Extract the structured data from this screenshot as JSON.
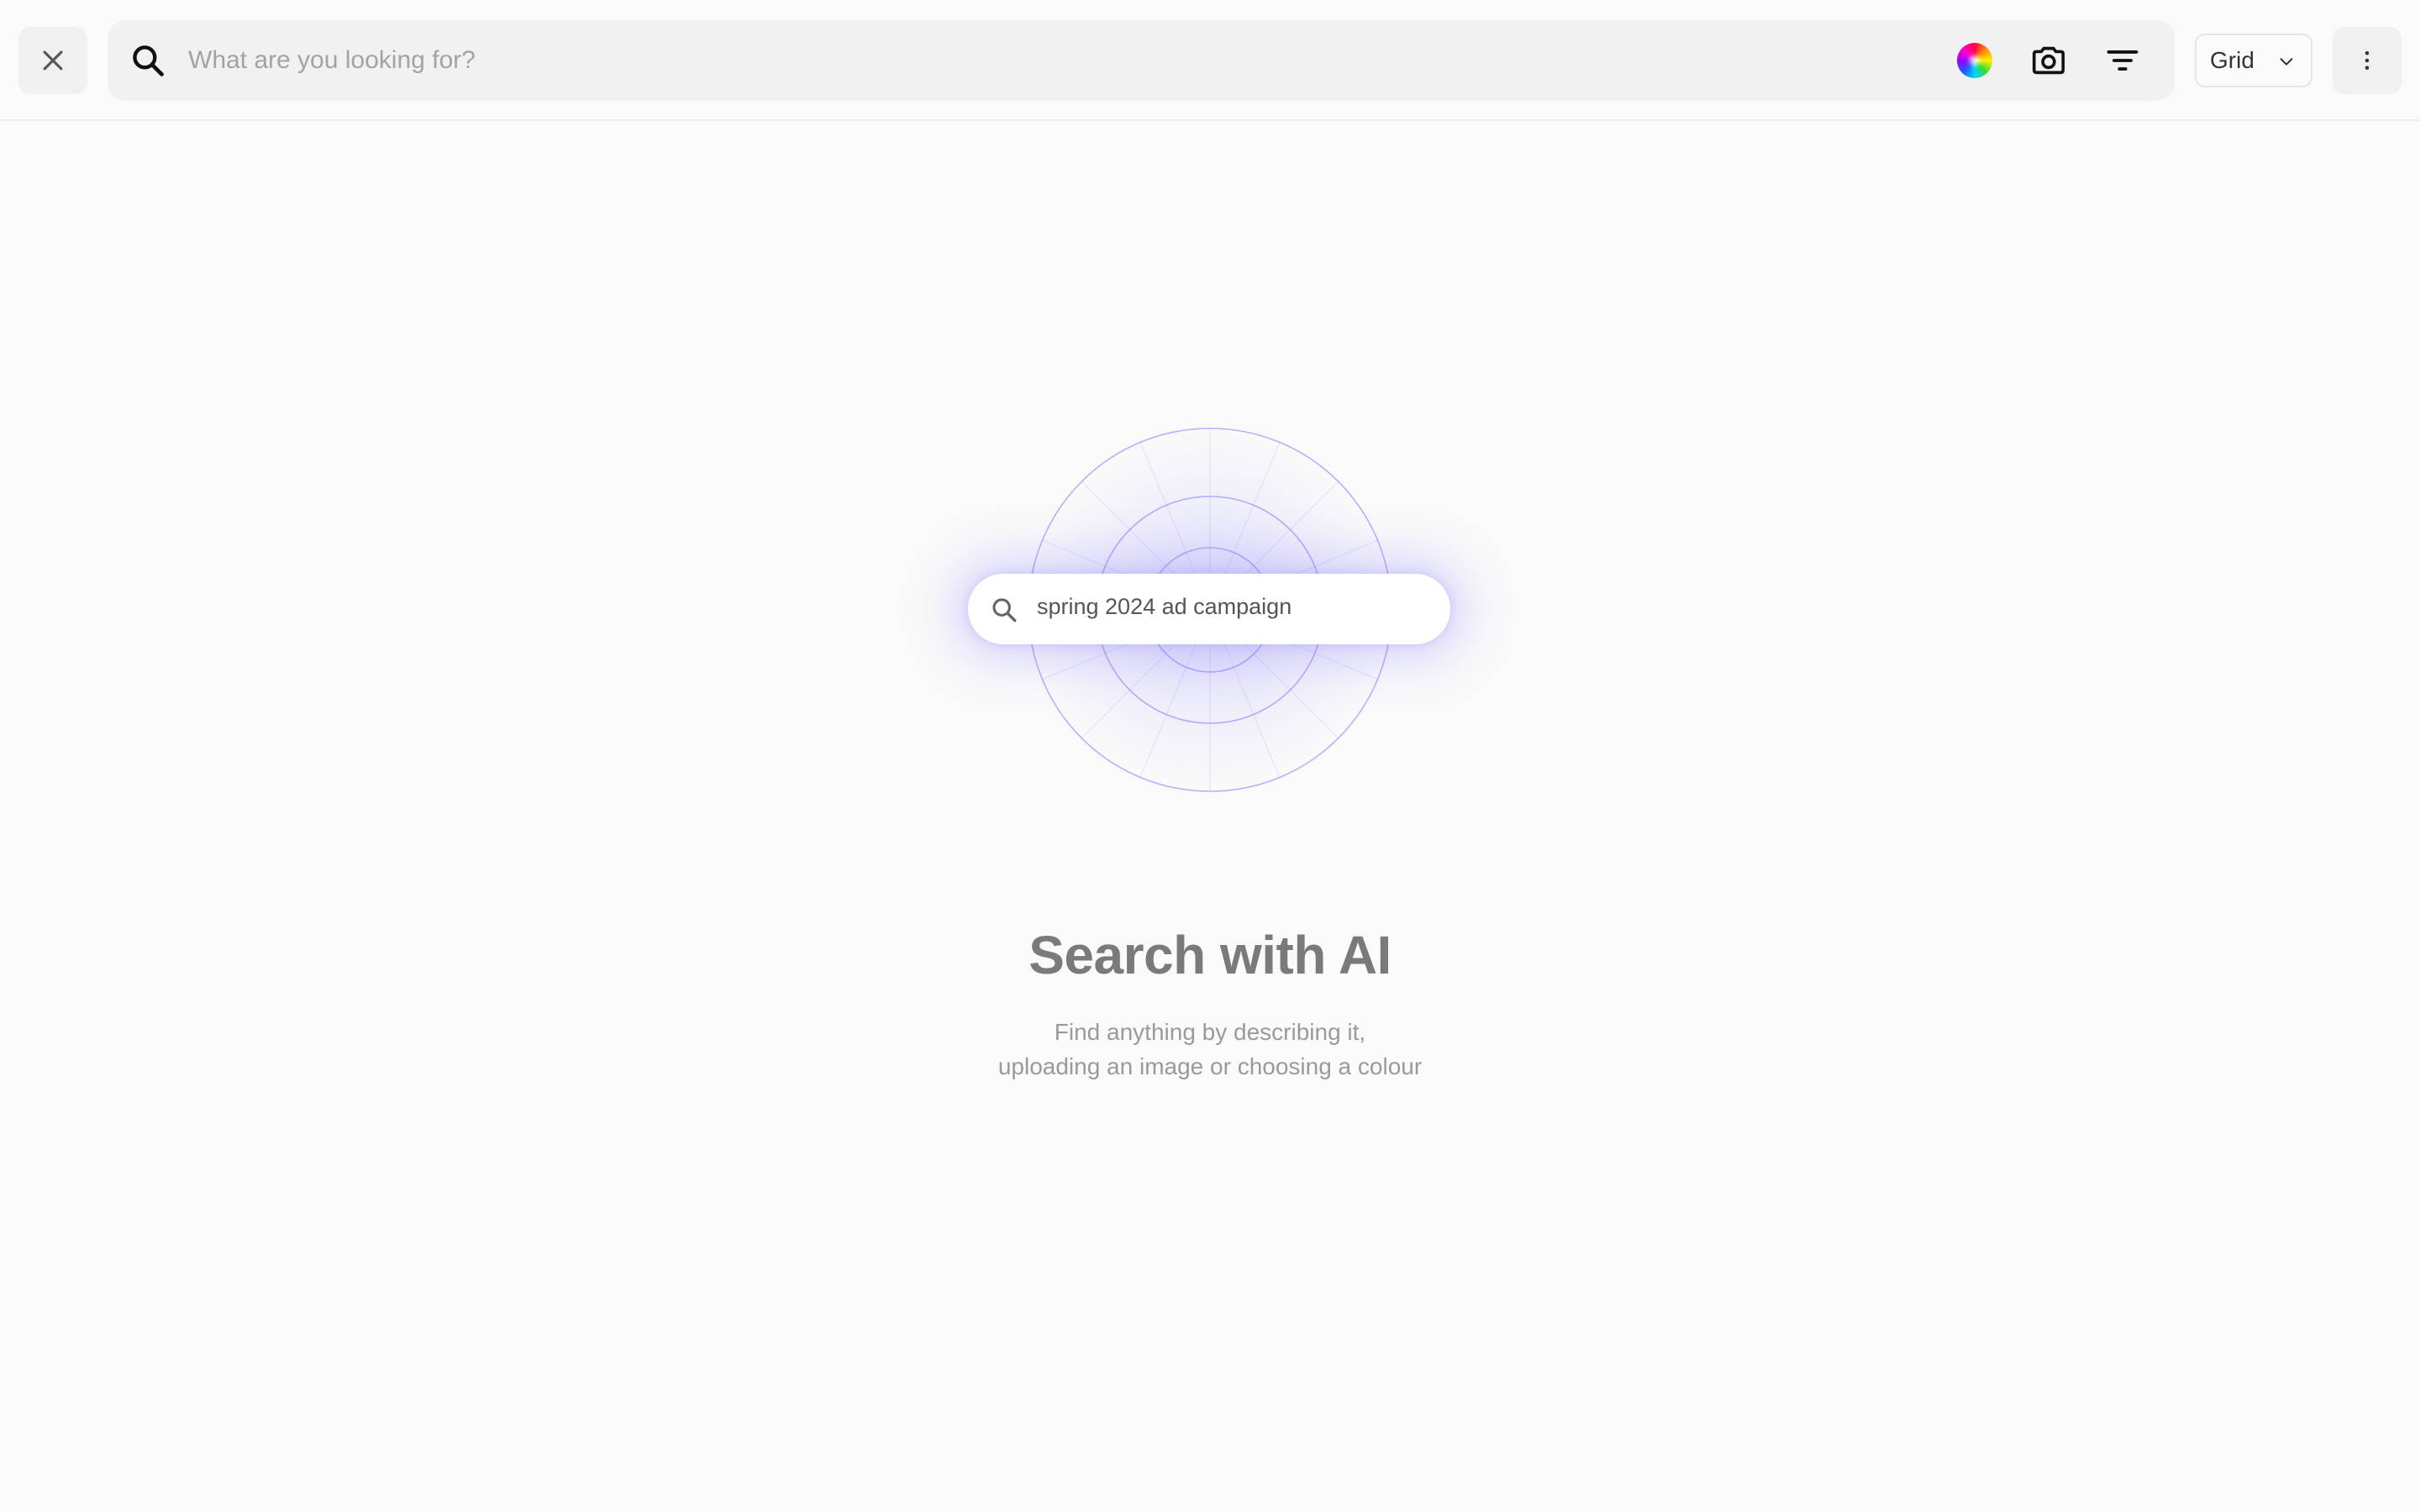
{
  "toolbar": {
    "search_placeholder": "What are you looking for?",
    "search_value": "",
    "view_mode": "Grid",
    "icons": [
      "close-icon",
      "search-icon",
      "color-wheel-icon",
      "camera-icon",
      "filter-icon",
      "chevron-down-icon",
      "more-vertical-icon"
    ]
  },
  "hero": {
    "example_query": "spring 2024 ad campaign",
    "title": "Search with AI",
    "subtitle_line1": "Find anything by describing it,",
    "subtitle_line2": "uploading an image or choosing a colour",
    "accent_color": "#7c74ff"
  }
}
